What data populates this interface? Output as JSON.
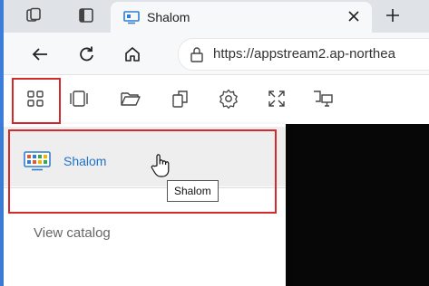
{
  "browser": {
    "tab": {
      "title": "Shalom",
      "favicon": "appstream-tab-icon"
    },
    "new_tab_symbol": "+",
    "close_symbol": "×",
    "address": {
      "url": "https://appstream2.ap-northea"
    }
  },
  "toolbar": {
    "buttons": [
      "apps-grid-icon",
      "windows-icon",
      "folder-icon",
      "copy-icon",
      "gear-icon",
      "fullscreen-icon",
      "display-icon"
    ]
  },
  "menu": {
    "app_item": {
      "label": "Shalom"
    },
    "tooltip": "Shalom",
    "catalog_label": "View catalog"
  },
  "colors": {
    "highlight": "#d62a2a",
    "link": "#1f73c9",
    "dark_area": "#070707"
  }
}
